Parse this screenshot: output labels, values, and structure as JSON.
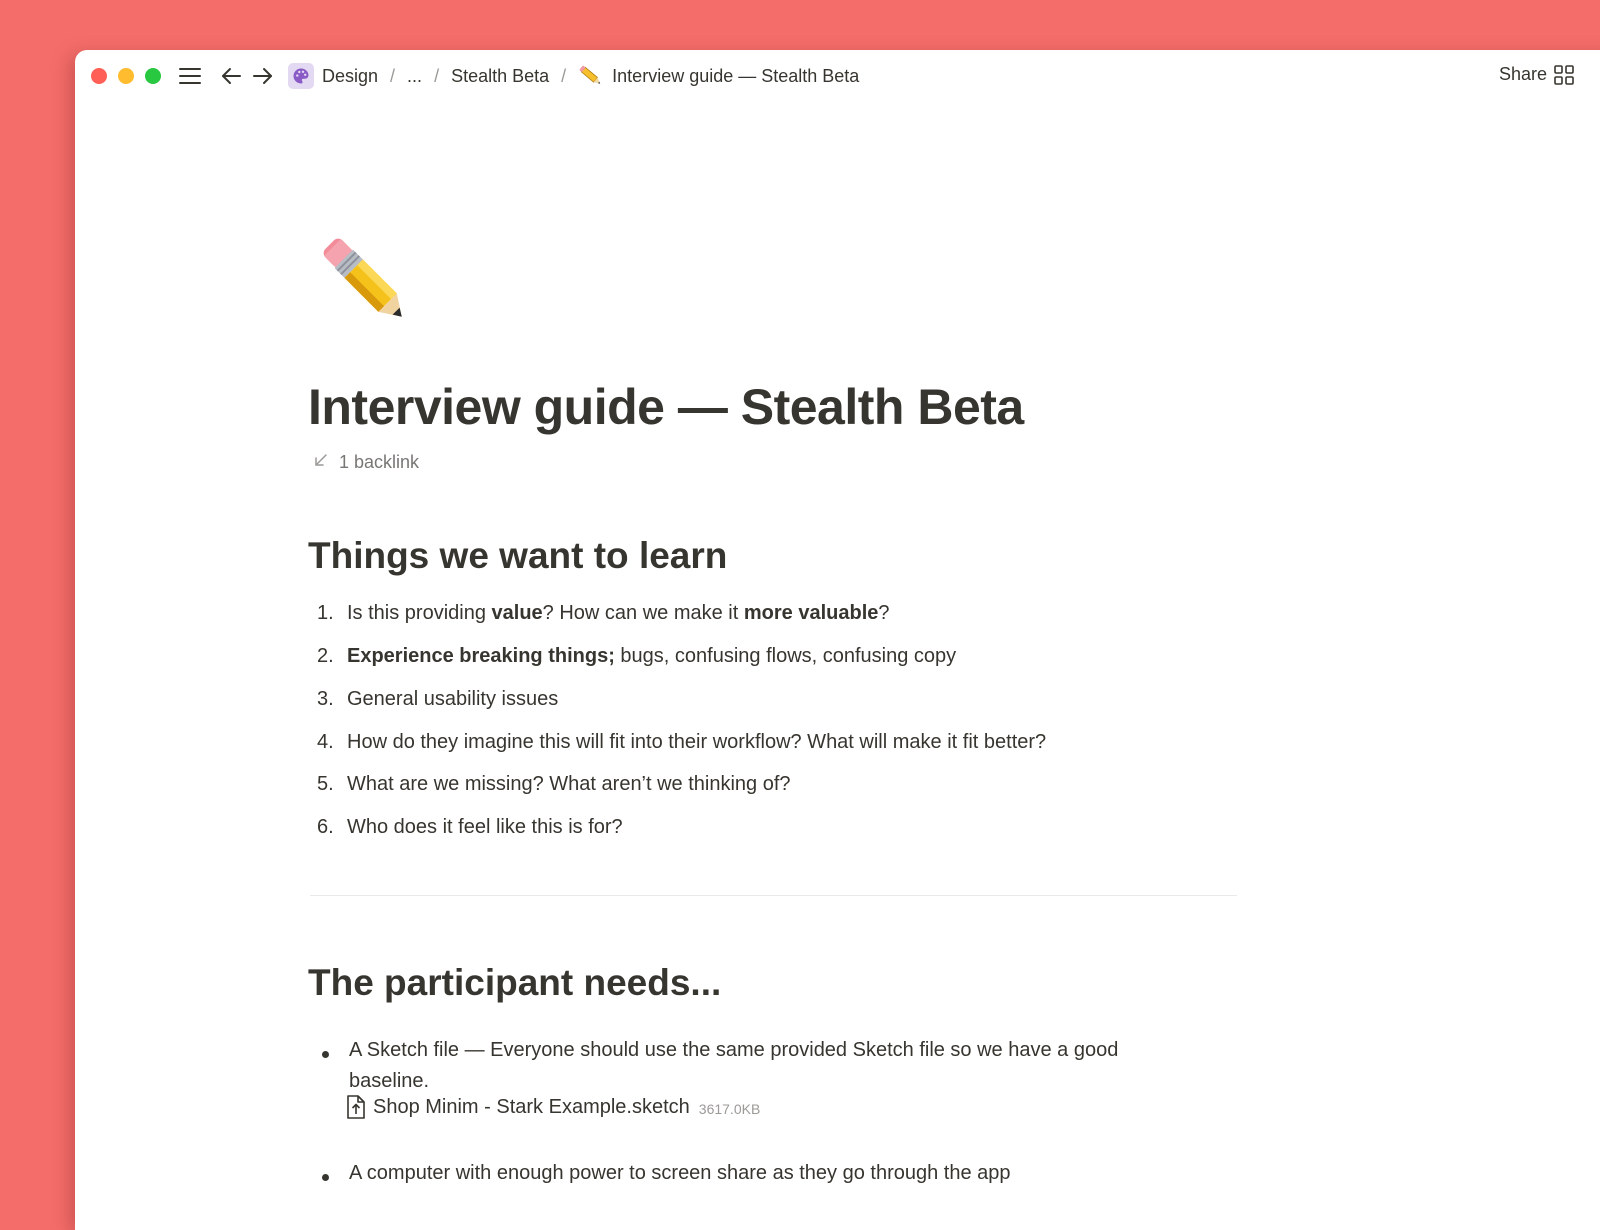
{
  "topbar": {
    "breadcrumbs": {
      "workspace": "Design",
      "ellipsis": "...",
      "parent": "Stealth Beta",
      "current": "Interview guide — Stealth Beta",
      "separator": "/"
    },
    "share_label": "Share"
  },
  "page": {
    "icon": "pencil-emoji",
    "title": "Interview guide — Stealth Beta",
    "backlinks": "1 backlink"
  },
  "section1": {
    "heading": "Things we want to learn",
    "items": [
      {
        "num": "1.",
        "parts": [
          "Is this providing ",
          "value",
          "? How can we make it ",
          "more valuable",
          "?"
        ]
      },
      {
        "num": "2.",
        "parts": [
          "Experience breaking things;",
          " bugs, confusing flows, confusing copy"
        ]
      },
      {
        "num": "3.",
        "text": "General usability issues"
      },
      {
        "num": "4.",
        "text": "How do they imagine this will fit into their workflow? What will make it fit better?"
      },
      {
        "num": "5.",
        "text": "What are we missing? What aren’t we thinking of?"
      },
      {
        "num": "6.",
        "text": "Who does it feel like this is for?"
      }
    ]
  },
  "section2": {
    "heading": "The participant needs...",
    "items": [
      {
        "text": "A Sketch file — Everyone should use the same provided Sketch file so we have a good baseline."
      },
      {
        "text": "A computer with enough power to screen share as they go through the app"
      }
    ],
    "file": {
      "name": "Shop Minim - Stark Example.sketch",
      "size": "3617.0KB"
    }
  },
  "colors": {
    "background": "#f56d6a",
    "text": "#37352f",
    "muted": "#787774"
  }
}
